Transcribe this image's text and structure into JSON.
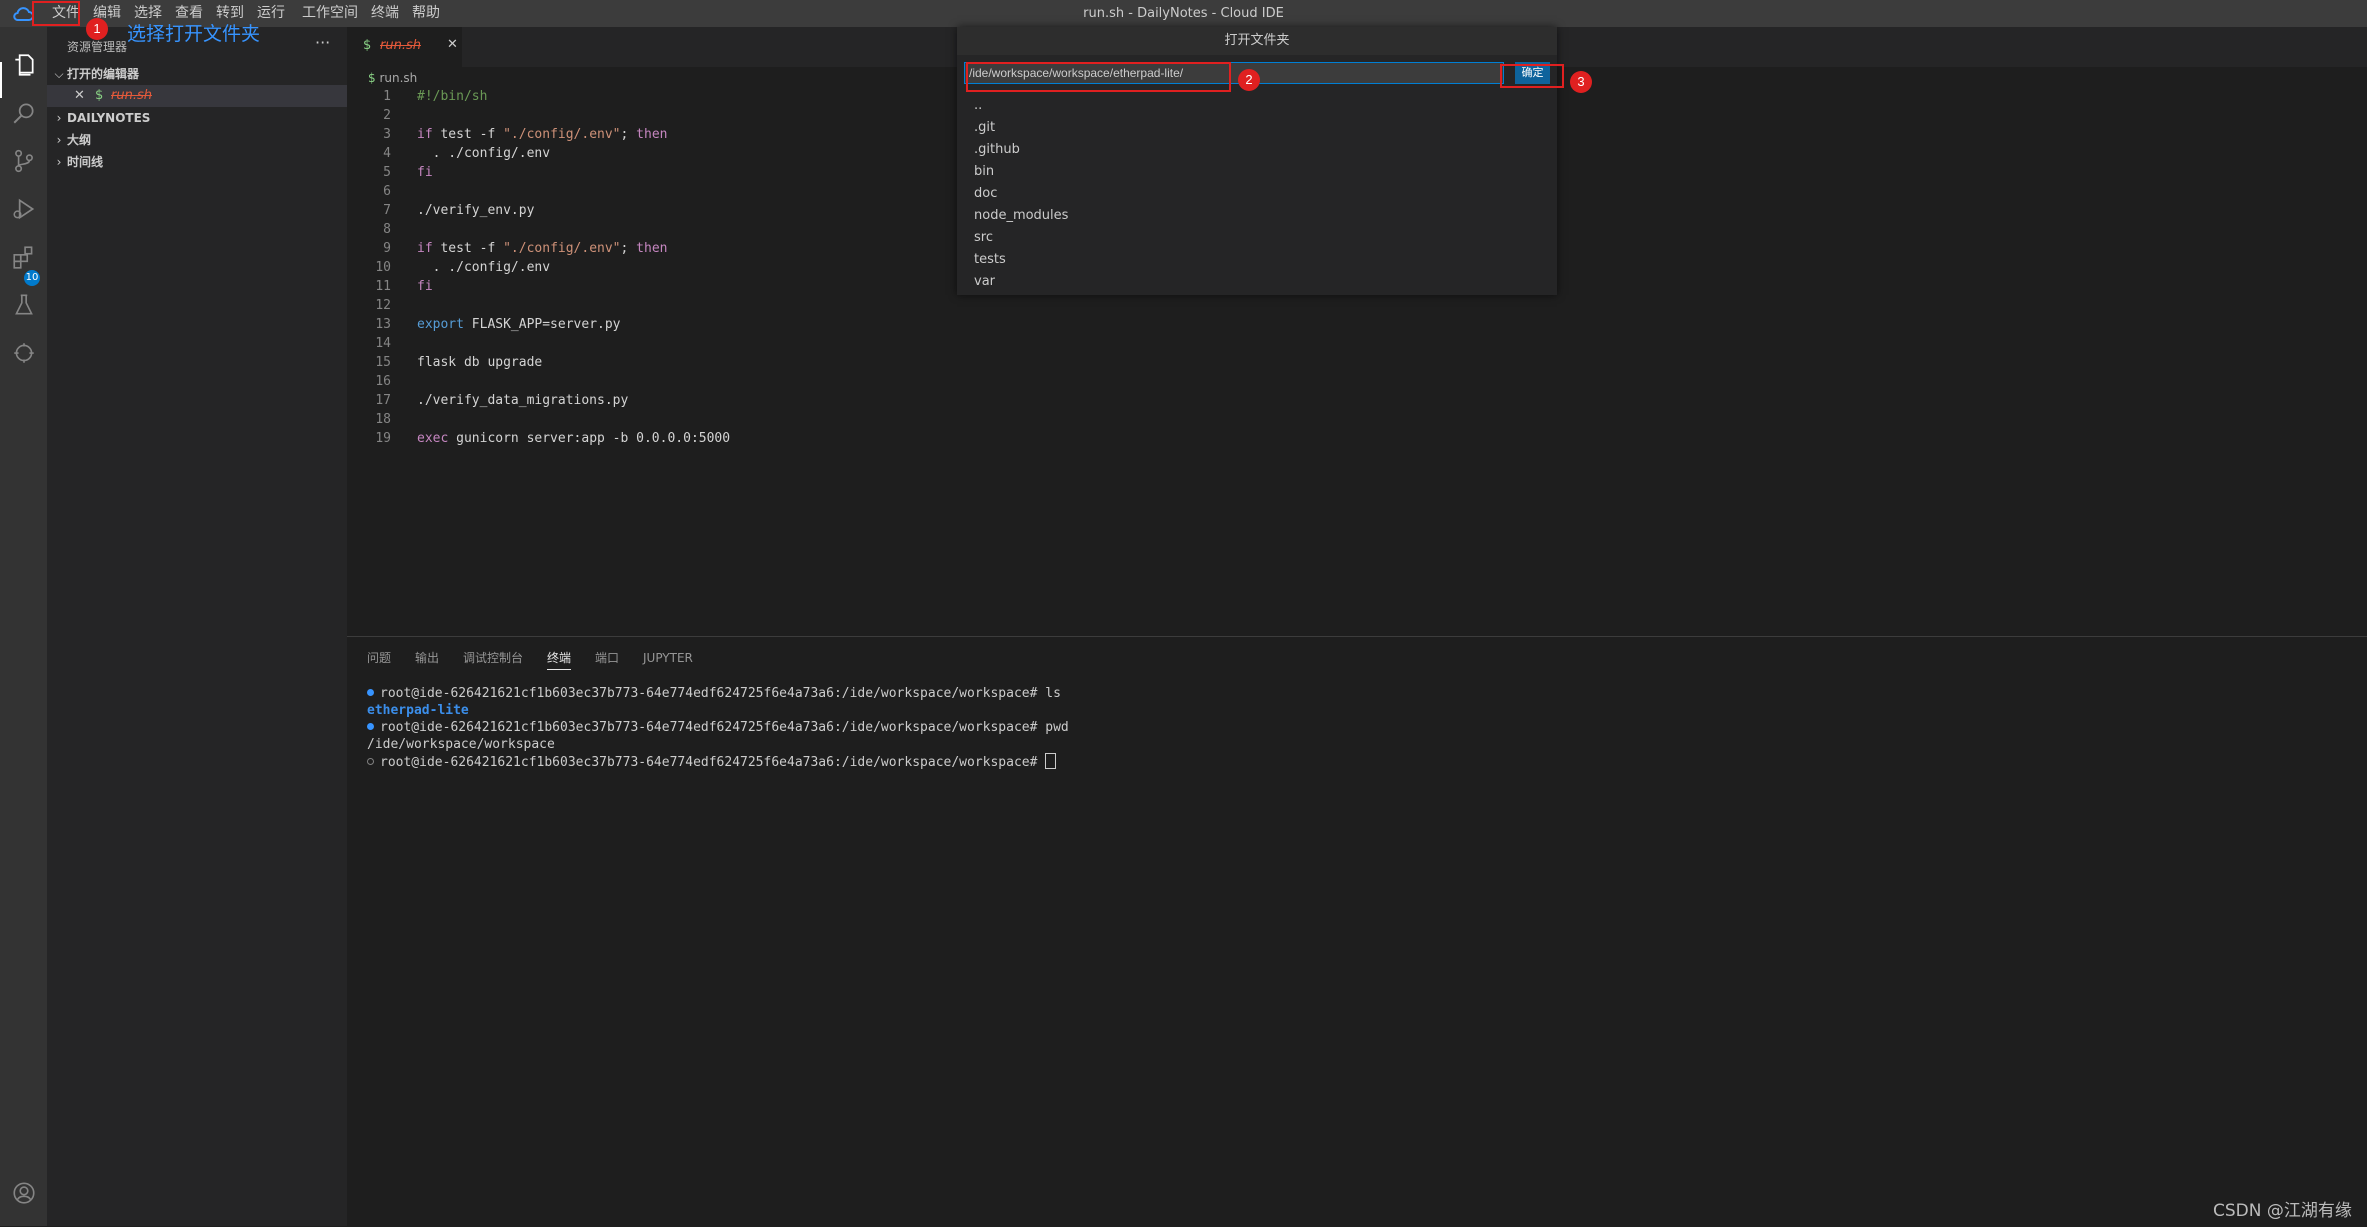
{
  "titlebar": {
    "title": "run.sh - DailyNotes - Cloud IDE",
    "menu": [
      "文件",
      "编辑",
      "选择",
      "查看",
      "转到",
      "运行",
      "工作空间",
      "终端",
      "帮助"
    ]
  },
  "activitybar": {
    "icons": [
      "explorer-icon",
      "search-icon",
      "source-control-icon",
      "run-debug-icon",
      "extensions-icon",
      "testing-icon",
      "remote-icon",
      "account-icon"
    ],
    "extensions_badge": "10"
  },
  "sidebar": {
    "title": "资源管理器",
    "more": "···",
    "sections": {
      "open_editors": "打开的编辑器",
      "open_editor_file": "run.sh",
      "dailynotes": "DAILYNOTES",
      "outline": "大纲",
      "timeline": "时间线"
    }
  },
  "editor": {
    "tab_label": "run.sh",
    "breadcrumb": "run.sh",
    "file_icon": "$",
    "lines": [
      "#!/bin/sh",
      "",
      "if test -f \"./config/.env\"; then",
      "  . ./config/.env",
      "fi",
      "",
      "./verify_env.py",
      "",
      "if test -f \"./config/.env\"; then",
      "  . ./config/.env",
      "fi",
      "",
      "export FLASK_APP=server.py",
      "",
      "flask db upgrade",
      "",
      "./verify_data_migrations.py",
      "",
      "exec gunicorn server:app -b 0.0.0.0:5000"
    ]
  },
  "panel": {
    "tabs": [
      "问题",
      "输出",
      "调试控制台",
      "终端",
      "端口",
      "JUPYTER"
    ],
    "active_tab": "终端",
    "terminal": {
      "prompt1": "root@ide-626421621cf1b603ec37b773-64e774edf624725f6e4a73a6:/ide/workspace/workspace# ls",
      "out1": "etherpad-lite",
      "prompt2": "root@ide-626421621cf1b603ec37b773-64e774edf624725f6e4a73a6:/ide/workspace/workspace# pwd",
      "out2": "/ide/workspace/workspace",
      "prompt3": "root@ide-626421621cf1b603ec37b773-64e774edf624725f6e4a73a6:/ide/workspace/workspace# "
    }
  },
  "dialog": {
    "title": "打开文件夹",
    "path_value": "/ide/workspace/workspace/etherpad-lite/",
    "ok_label": "确定",
    "items": [
      "..",
      ".git",
      ".github",
      "bin",
      "doc",
      "node_modules",
      "src",
      "tests",
      "var"
    ]
  },
  "annotations": {
    "step1": "1",
    "step2": "2",
    "step3": "3",
    "note": "选择打开文件夹",
    "color": "#e02020"
  },
  "watermark": "CSDN @江湖有缘"
}
